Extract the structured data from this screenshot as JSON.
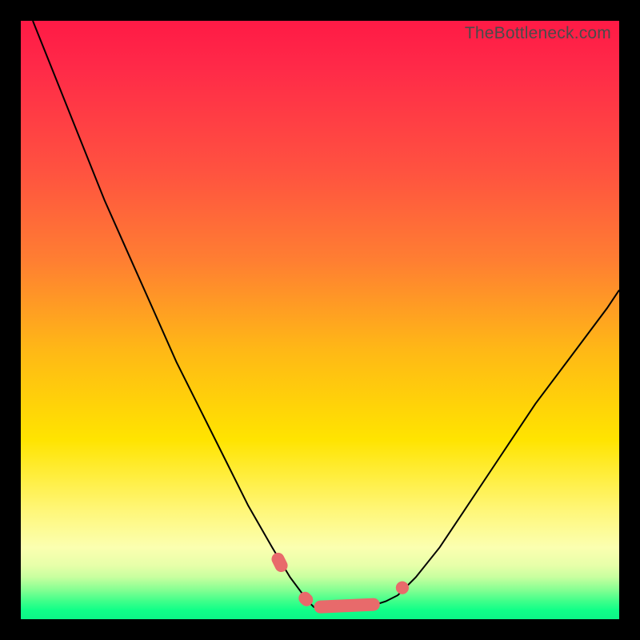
{
  "watermark": "TheBottleneck.com",
  "colors": {
    "frame": "#000000",
    "curve": "#000000",
    "highlight": "#e86a6b"
  },
  "chart_data": {
    "type": "line",
    "title": "",
    "xlabel": "",
    "ylabel": "",
    "xlim": [
      0,
      100
    ],
    "ylim": [
      0,
      100
    ],
    "series": [
      {
        "name": "bottleneck-curve",
        "x": [
          2,
          6,
          10,
          14,
          18,
          22,
          26,
          30,
          34,
          38,
          42,
          45,
          48,
          49,
          53,
          58,
          61,
          63,
          66,
          70,
          74,
          80,
          86,
          92,
          98,
          100
        ],
        "y": [
          100,
          90,
          80,
          70,
          61,
          52,
          43,
          35,
          27,
          19,
          12,
          7,
          3,
          2,
          2,
          2,
          3,
          4,
          7,
          12,
          18,
          27,
          36,
          44,
          52,
          55
        ]
      }
    ],
    "highlight_segments": [
      {
        "x_start": 42.5,
        "x_end": 44.0,
        "y_start": 11,
        "y_end": 8
      },
      {
        "x_start": 47.0,
        "x_end": 48.0,
        "y_start": 4,
        "y_end": 3
      },
      {
        "x_start": 49.0,
        "x_end": 60.0,
        "y_start": 2,
        "y_end": 2.5
      },
      {
        "x_start": 63.0,
        "x_end": 64.5,
        "y_start": 4.5,
        "y_end": 6
      }
    ],
    "gradient_stops": [
      {
        "pos": 0.0,
        "color": "#ff1a46"
      },
      {
        "pos": 0.25,
        "color": "#ff5240"
      },
      {
        "pos": 0.55,
        "color": "#ffb816"
      },
      {
        "pos": 0.82,
        "color": "#fff77a"
      },
      {
        "pos": 1.0,
        "color": "#0cf587"
      }
    ]
  }
}
